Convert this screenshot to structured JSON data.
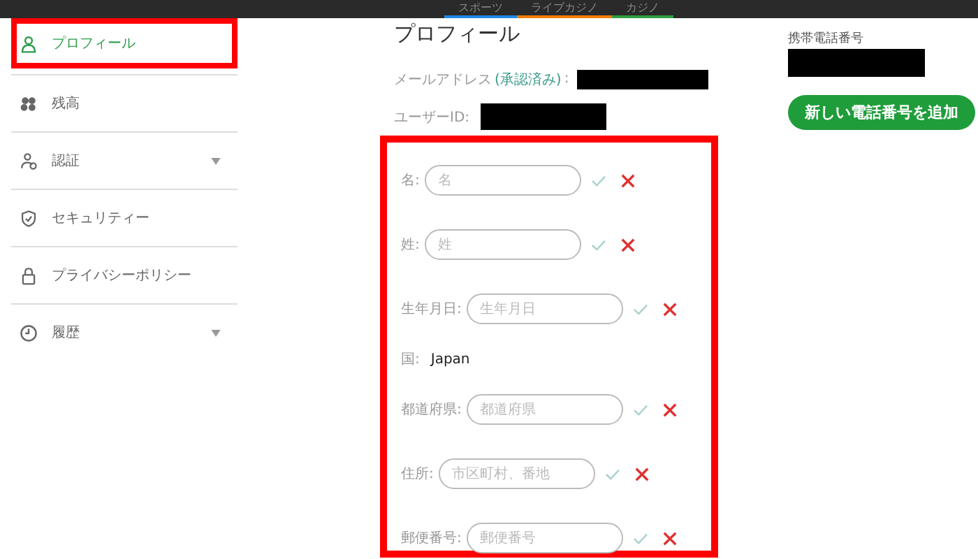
{
  "top_tabs": [
    {
      "label": "スポーツ",
      "color": "#1e88e5"
    },
    {
      "label": "ライブカジノ",
      "color": "#f57c00"
    },
    {
      "label": "カジノ",
      "color": "#2e9e3e"
    }
  ],
  "sidebar": {
    "items": [
      {
        "label": "プロフィール",
        "selected": true,
        "expandable": false
      },
      {
        "label": "残高",
        "selected": false,
        "expandable": false
      },
      {
        "label": "認証",
        "selected": false,
        "expandable": true
      },
      {
        "label": "セキュリティー",
        "selected": false,
        "expandable": false
      },
      {
        "label": "プライバシーポリシー",
        "selected": false,
        "expandable": false
      },
      {
        "label": "履歴",
        "selected": false,
        "expandable": true
      }
    ]
  },
  "profile": {
    "title": "プロフィール",
    "email_label": "メールアドレス",
    "email_status": "(承認済み)",
    "email_colon": ":",
    "user_id_label": "ユーザーID:",
    "fields": [
      {
        "kind": "input",
        "label": "名:",
        "placeholder": "名"
      },
      {
        "kind": "input",
        "label": "姓:",
        "placeholder": "姓"
      },
      {
        "kind": "input",
        "label": "生年月日:",
        "placeholder": "生年月日"
      },
      {
        "kind": "static",
        "label": "国:",
        "value": "Japan"
      },
      {
        "kind": "input",
        "label": "都道府県:",
        "placeholder": "都道府県"
      },
      {
        "kind": "input",
        "label": "住所:",
        "placeholder": "市区町村、番地"
      },
      {
        "kind": "input",
        "label": "郵便番号:",
        "placeholder": "郵便番号"
      }
    ]
  },
  "phone": {
    "label": "携帯電話番号",
    "add_button": "新しい電話番号を追加"
  }
}
